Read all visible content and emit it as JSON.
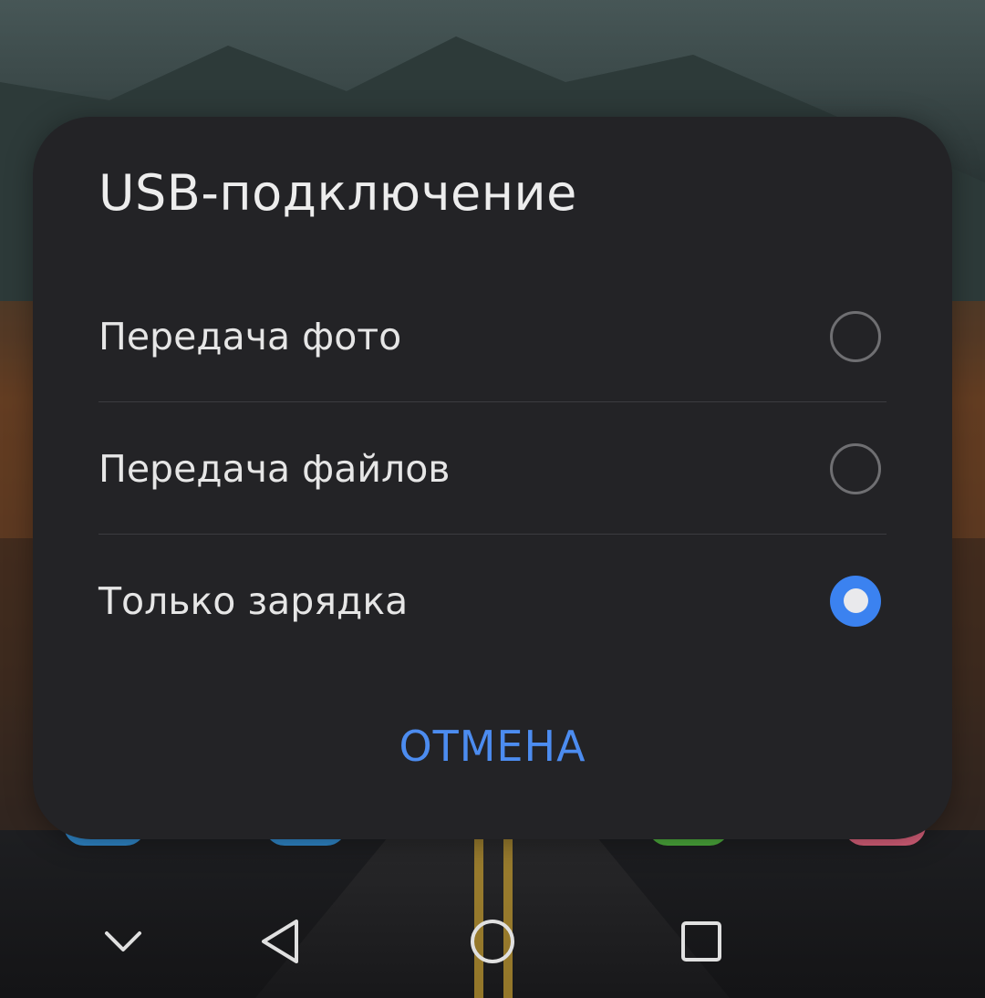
{
  "dialog": {
    "title": "USB-подключение",
    "options": [
      {
        "label": "Передача фото",
        "selected": false
      },
      {
        "label": "Передача файлов",
        "selected": false
      },
      {
        "label": "Только зарядка",
        "selected": true
      }
    ],
    "cancel_label": "ОТМЕНА"
  },
  "navbar": {
    "buttons": [
      "chevron-down-icon",
      "back-icon",
      "home-icon",
      "recents-icon"
    ]
  },
  "colors": {
    "accent": "#3b82f0",
    "dialog_bg": "#232326",
    "cancel_text": "#4c8cf0"
  }
}
